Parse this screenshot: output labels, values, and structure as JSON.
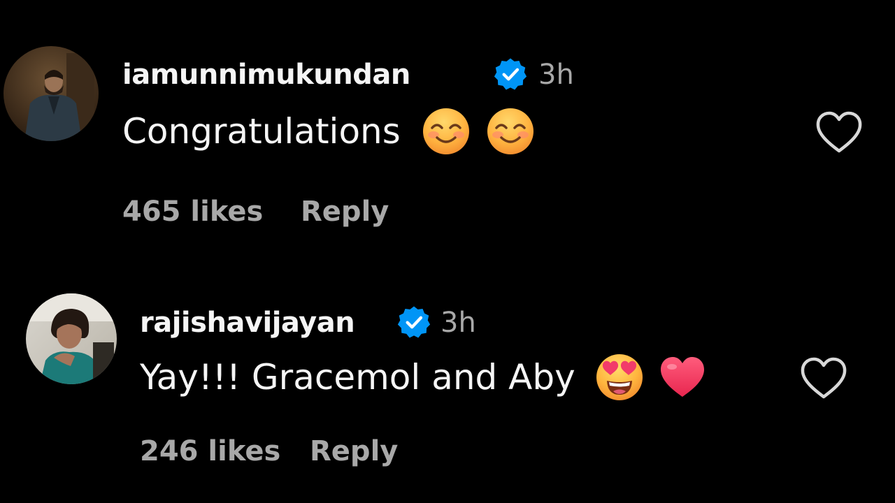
{
  "comments": [
    {
      "username": "iamunnimukundan",
      "time": "3h",
      "text": "Congratulations",
      "emojis": [
        "smiling-face-with-smiling-eyes-emoji",
        "smiling-face-with-smiling-eyes-emoji"
      ],
      "likes": "465 likes",
      "reply": "Reply",
      "verified": true
    },
    {
      "username": "rajishavijayan",
      "time": "3h",
      "text": "Yay!!! Gracemol and Aby",
      "emojis": [
        "heart-eyes-emoji",
        "red-heart-emoji"
      ],
      "likes": "246 likes",
      "reply": "Reply",
      "verified": true
    }
  ],
  "colors": {
    "background": "#000000",
    "primary_text": "#f5f5f5",
    "secondary_text": "#a8a8a8",
    "verified_blue": "#0095f6"
  }
}
